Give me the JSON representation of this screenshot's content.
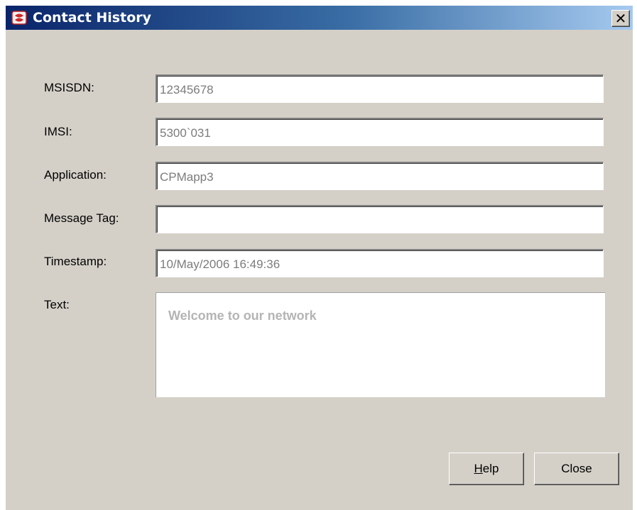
{
  "window": {
    "title": "Contact History",
    "close_glyph": "✕",
    "icon": "app-logo-icon"
  },
  "form": {
    "msisdn": {
      "label": "MSISDN:",
      "value": "12345678"
    },
    "imsi": {
      "label": "IMSI:",
      "value": "5300`031"
    },
    "application": {
      "label": "Application:",
      "value": "CPMapp3"
    },
    "message_tag": {
      "label": "Message Tag:",
      "value": ""
    },
    "timestamp": {
      "label": "Timestamp:",
      "value": "10/May/2006 16:49:36"
    },
    "text": {
      "label": "Text:",
      "value": "Welcome to our network"
    }
  },
  "buttons": {
    "help_accel": "H",
    "help_rest": "elp",
    "close": "Close"
  },
  "colors": {
    "titlebar_start": "#0a246a",
    "titlebar_end": "#a6caf0",
    "dialog_bg": "#d4d0c8",
    "field_text": "#7c7c7c"
  }
}
